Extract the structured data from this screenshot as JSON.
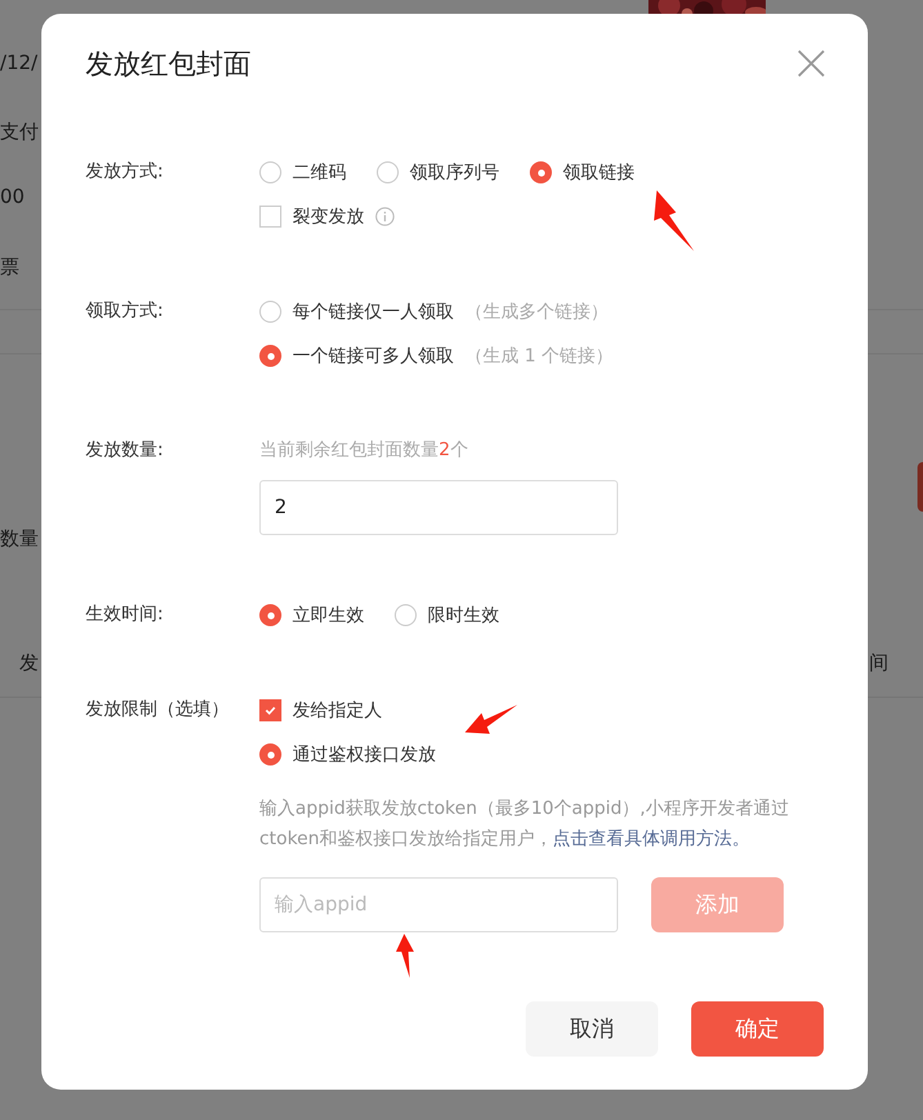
{
  "background_page": {
    "texts": [
      "/12/",
      "支付",
      "00",
      "票",
      "数量",
      "发",
      "间"
    ]
  },
  "dialog": {
    "title": "发放红包封面",
    "sections": [
      {
        "label": "发放方式:",
        "rows": [
          [
            {
              "kind": "radio",
              "label": "二维码",
              "selected": false
            },
            {
              "kind": "radio",
              "label": "领取序列号",
              "selected": false
            },
            {
              "kind": "radio",
              "label": "领取链接",
              "selected": true
            }
          ],
          [
            {
              "kind": "checkbox",
              "label": "裂变发放",
              "checked": false,
              "info": true
            }
          ]
        ]
      },
      {
        "label": "领取方式:",
        "rows": [
          [
            {
              "kind": "radio",
              "label": "每个链接仅一人领取",
              "note": "（生成多个链接）",
              "selected": false
            }
          ],
          [
            {
              "kind": "radio",
              "label": "一个链接可多人领取",
              "note": "（生成 1 个链接）",
              "selected": true
            }
          ]
        ]
      },
      {
        "label": "发放数量:",
        "hint": {
          "before": "当前剩余红包封面数量",
          "count": "2",
          "after": "个"
        },
        "field": {
          "value": "2"
        }
      },
      {
        "label": "生效时间:",
        "rows": [
          [
            {
              "kind": "radio",
              "label": "立即生效",
              "selected": true
            },
            {
              "kind": "radio",
              "label": "限时生效",
              "selected": false
            }
          ]
        ]
      },
      {
        "label": "发放限制（选填）",
        "rows": [
          [
            {
              "kind": "checkbox",
              "label": "发给指定人",
              "checked": true
            }
          ],
          [
            {
              "kind": "radio",
              "label": "通过鉴权接口发放",
              "selected": true
            }
          ]
        ],
        "description": {
          "text": "输入appid获取发放ctoken（最多10个appid）,小程序开发者通过ctoken和鉴权接口发放给指定用户，",
          "link": "点击查看具体调用方法。"
        },
        "field": {
          "placeholder": "输入appid"
        },
        "add_button": {
          "label": "添加",
          "disabled": true
        }
      }
    ],
    "buttons": [
      {
        "kind": "secondary",
        "label": "取消"
      },
      {
        "kind": "primary",
        "label": "确定"
      }
    ]
  }
}
